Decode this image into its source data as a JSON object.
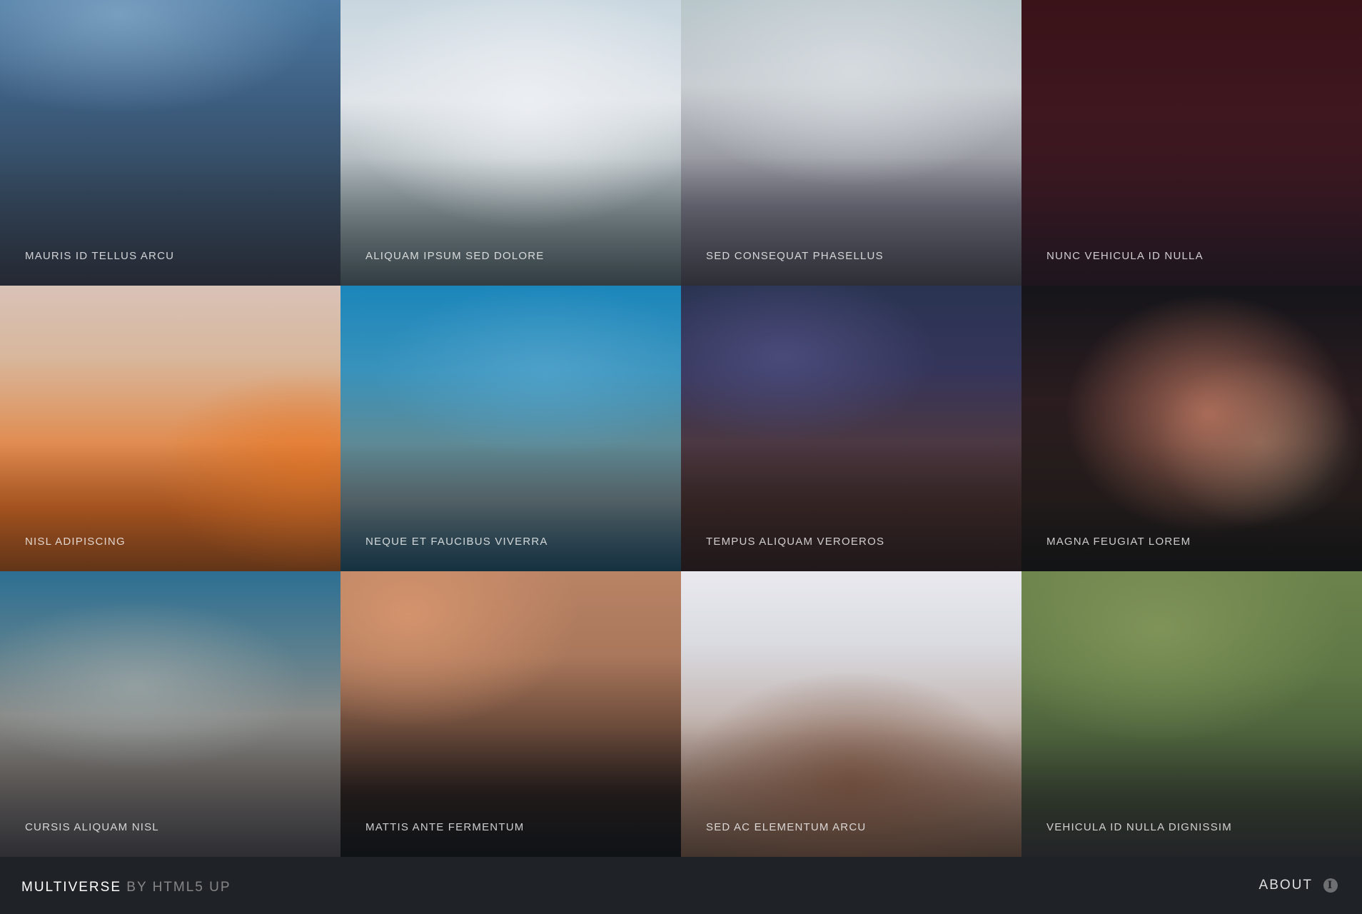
{
  "gallery": {
    "items": [
      {
        "caption": "MAURIS ID TELLUS ARCU"
      },
      {
        "caption": "ALIQUAM IPSUM SED DOLORE"
      },
      {
        "caption": "SED CONSEQUAT PHASELLUS"
      },
      {
        "caption": "NUNC VEHICULA ID NULLA"
      },
      {
        "caption": "NISL ADIPISCING"
      },
      {
        "caption": "NEQUE ET FAUCIBUS VIVERRA"
      },
      {
        "caption": "TEMPUS ALIQUAM VEROEROS"
      },
      {
        "caption": "MAGNA FEUGIAT LOREM"
      },
      {
        "caption": "CURSIS ALIQUAM NISL"
      },
      {
        "caption": "MATTIS ANTE FERMENTUM"
      },
      {
        "caption": "SED AC ELEMENTUM ARCU"
      },
      {
        "caption": "VEHICULA ID NULLA DIGNISSIM"
      }
    ]
  },
  "footer": {
    "brand_name": "MULTIVERSE",
    "brand_by": "BY HTML5 UP",
    "about_label": "ABOUT",
    "about_icon": "info-icon",
    "info_glyph": "i",
    "background_color": "#1f2226"
  }
}
